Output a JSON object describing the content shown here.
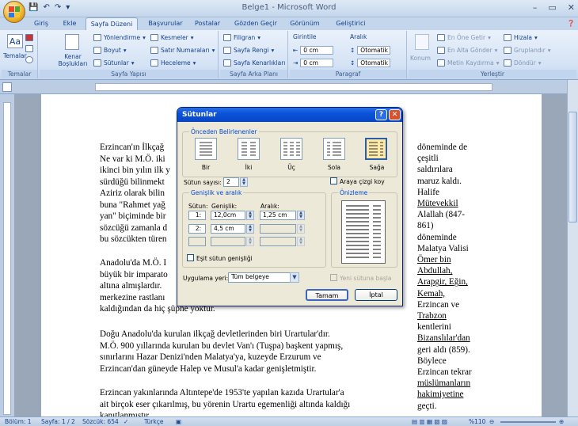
{
  "window": {
    "title": "Belge1 - Microsoft Word"
  },
  "tabs": [
    "Giriş",
    "Ekle",
    "Sayfa Düzeni",
    "Başvurular",
    "Postalar",
    "Gözden Geçir",
    "Görünüm",
    "Geliştirici"
  ],
  "active_tab": "Sayfa Düzeni",
  "ribbon": {
    "temalar": {
      "button": "Temalar",
      "label": "Temalar"
    },
    "sayfa_yapisi": {
      "kenar": "Kenar Boşlukları",
      "yonlendirme": "Yönlendirme",
      "boyut": "Boyut",
      "sutunlar": "Sütunlar",
      "kesmeler": "Kesmeler",
      "satir_numaralari": "Satır Numaraları",
      "heceleme": "Heceleme",
      "label": "Sayfa Yapısı"
    },
    "sayfa_arka_plani": {
      "filigran": "Filigran",
      "sayfa_rengi": "Sayfa Rengi",
      "sayfa_kenarliklari": "Sayfa Kenarlıkları",
      "label": "Sayfa Arka Planı"
    },
    "paragraf": {
      "girinti": "Girintile",
      "aralik": "Aralık",
      "sol": "0 cm",
      "sag": "0 cm",
      "once": "Otomatik",
      "sonra": "Otomatik",
      "label": "Paragraf"
    },
    "yerlestir": {
      "konum": "Konum",
      "en_one": "En Öne Getir",
      "en_alta": "En Alta Gönder",
      "metin_kaydirma": "Metin Kaydırma",
      "hizala": "Hizala",
      "grupla": "Gruplandır",
      "dondur": "Döndür",
      "label": "Yerleştir"
    }
  },
  "document": {
    "left_lines": [
      "Erzincan'ın İlkçağ",
      "Ne var ki M.Ö. iki",
      "ikinci bin yılın ilk y",
      "sürdüğü bilinmekt",
      "Aziriz olarak bilin",
      "buna \"Rahmet yağ",
      "yan\" biçiminde bir",
      "sözcüğü zamanla d",
      "bu sözcükten türen"
    ],
    "left_lines2": [
      "Anadolu'da M.Ö. I",
      "büyük bir imparato",
      "altına almışlardır.",
      "merkezine rastlanı",
      "kaldığından da hiç şüphe yoktur."
    ],
    "paragraph3": [
      "Doğu Anadolu'da kurulan ilkçağ devletlerinden biri Urartular'dır.",
      "M.Ö. 900 yıllarında kurulan bu devlet Van'ı (Tuşpa) başkent yapmış,",
      "sınırlarını Hazar Denizi'nden Malatya'ya, kuzeyde Erzurum ve",
      "Erzincan'dan güneyde Halep ve Musul'a kadar genişletmiştir."
    ],
    "paragraph4": [
      "Erzincan yakınlarında Altıntepe'de 1953'te yapılan kazıda Urartular'a",
      "ait birçok eser çıkarılmış, bu yörenin Urartu egemenliği altında kaldığı",
      "kanıtlanmıştır."
    ],
    "right_column": [
      "döneminde de",
      "çeşitli",
      "saldırılara",
      "maruz kaldı.",
      "Halife",
      "Mütevekkil",
      "Alallah (847-",
      "861)",
      "döneminde",
      "Malatya Valisi",
      "Ömer bin",
      "Abdullah,",
      "Arapgir, Eğin,",
      "Kemah,",
      "Erzincan ve",
      "Trabzon",
      "kentlerini",
      "Bizanslılar'dan",
      "geri aldı (859).",
      "Böylece",
      "Erzincan tekrar",
      "müslümanların",
      "hakimiyetine",
      "geçti."
    ]
  },
  "dialog": {
    "title": "Sütunlar",
    "help": "?",
    "close": "✕",
    "presets_label": "Önceden Belirlenenler",
    "presets": [
      "Bir",
      "İki",
      "Üç",
      "Sola",
      "Sağa"
    ],
    "sutun_sayisi_label": "Sütun sayısı:",
    "sutun_sayisi": "2",
    "araya_cizgi": "Araya çizgi koy",
    "genislik_aralik": "Genişlik ve aralık",
    "col_headers": [
      "Sütun:",
      "Genişlik:",
      "Aralık:"
    ],
    "rows": [
      {
        "num": "1:",
        "width": "12,0cm",
        "spacing": "1,25 cm"
      },
      {
        "num": "2:",
        "width": "4,5 cm",
        "spacing": ""
      },
      {
        "num": "",
        "width": "",
        "spacing": ""
      }
    ],
    "esit_sutun": "Eşit sütun genişliği",
    "onizleme": "Önizleme",
    "uygulama_label": "Uygulama yeri:",
    "uygulama_value": "Tüm belgeye",
    "yeni_sutuna": "Yeni sütuna başla",
    "ok": "Tamam",
    "cancel": "İptal"
  },
  "status": {
    "bolum": "Bölüm: 1",
    "sayfa": "Sayfa: 1 / 2",
    "sozcuk": "Sözcük: 654",
    "dil": "Türkçe",
    "zoom": "%110"
  }
}
